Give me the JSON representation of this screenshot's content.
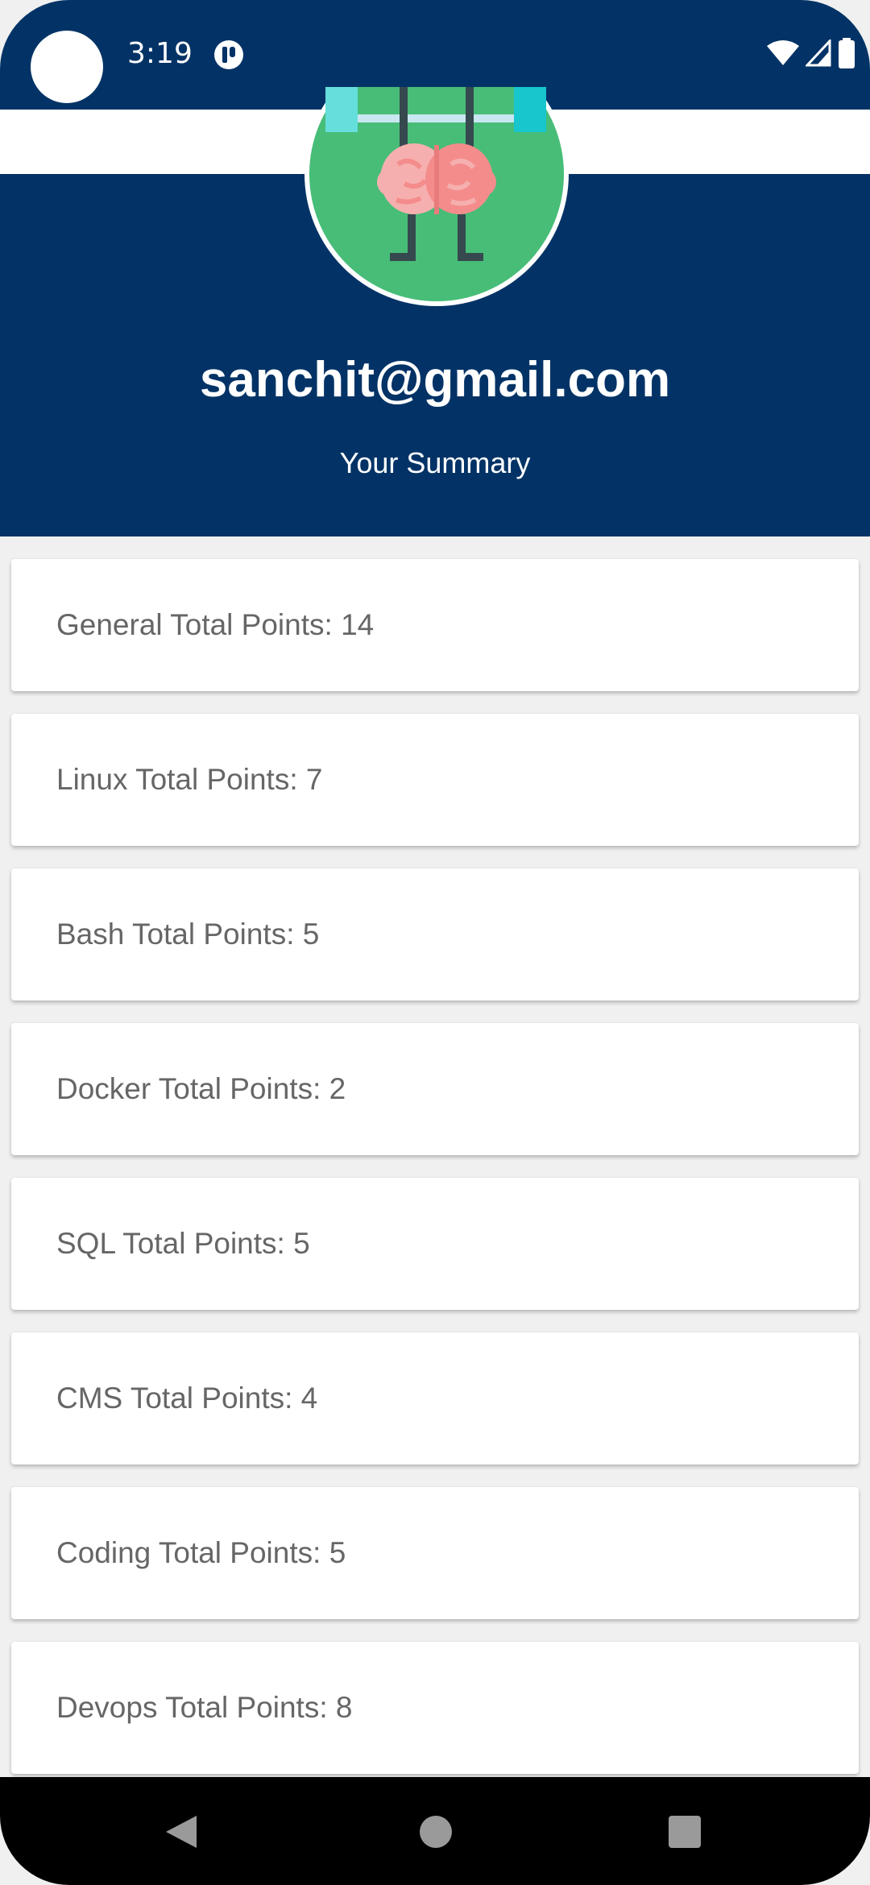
{
  "status_bar": {
    "time": "3:19",
    "icons": [
      "camera-cutout",
      "app-notification-icon",
      "wifi-icon",
      "cellular-signal-icon",
      "battery-icon"
    ]
  },
  "profile": {
    "email": "sanchit@gmail.com",
    "subtitle": "Your Summary",
    "avatar_icon": "brain-weightlifting-icon"
  },
  "summary": {
    "cards": [
      {
        "label": "General Total Points: 14"
      },
      {
        "label": "Linux Total Points: 7"
      },
      {
        "label": "Bash Total Points: 5"
      },
      {
        "label": "Docker Total Points: 2"
      },
      {
        "label": "SQL Total Points: 5"
      },
      {
        "label": "CMS Total Points: 4"
      },
      {
        "label": "Coding Total Points: 5"
      },
      {
        "label": "Devops Total Points: 8"
      }
    ]
  },
  "nav_bar": {
    "icons": [
      "back-icon",
      "home-icon",
      "recents-icon"
    ]
  },
  "colors": {
    "header_background": "#033366",
    "avatar_green": "#47BD78",
    "card_text": "#666666",
    "nav_background": "#000000"
  }
}
